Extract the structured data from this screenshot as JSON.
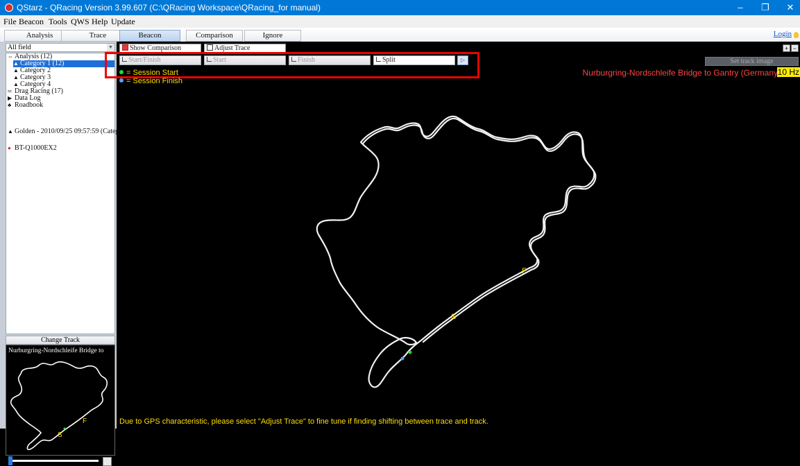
{
  "window": {
    "title": "QStarz - QRacing Version 3.99.607 (C:\\QRacing Workspace\\QRacing_for manual)",
    "controls": [
      "–",
      "❐",
      "✕"
    ]
  },
  "menu": [
    "File",
    "Beacon",
    "Tools",
    "QWS",
    "Help",
    "Update"
  ],
  "tabs": [
    {
      "label": "Analysis"
    },
    {
      "label": "Trace"
    },
    {
      "label": "Beacon"
    },
    {
      "label": "Comparison"
    },
    {
      "label": "Ignore"
    }
  ],
  "login_label": "Login",
  "sidebar": {
    "field_select": "All field",
    "tree": [
      {
        "label": "Analysis (12)",
        "icon": "analysis-icon"
      },
      {
        "label": "Category 1 (12)",
        "icon": "track-icon"
      },
      {
        "label": "Category 2",
        "icon": "track-icon"
      },
      {
        "label": "Category 3",
        "icon": "track-icon"
      },
      {
        "label": "Category 4",
        "icon": "track-icon"
      },
      {
        "label": "Drag Racing (17)",
        "icon": "drag-icon"
      },
      {
        "label": "Data Log",
        "icon": "flag-icon"
      },
      {
        "label": "Roadbook",
        "icon": "roadbook-icon"
      },
      {
        "label": "Golden - 2010/09/25 09:57:59 (Categ",
        "icon": "track-icon"
      },
      {
        "label": "BT-Q1000EX2",
        "icon": "device-icon"
      }
    ],
    "change_track_label": "Change Track",
    "minimap_title": "Nurburgring-Nordschleife Bridge to"
  },
  "toolbar": {
    "show_comparison": "Show Comparison",
    "adjust_trace": "Adjust Trace",
    "start_finish": "Start/Finish",
    "start": "Start",
    "finish": "Finish",
    "split": "Split",
    "set_track_image": "Set track image"
  },
  "legend": {
    "start_text": "= Session Start",
    "finish_text": "= Session Finish",
    "start_color": "#22dd22",
    "finish_color": "#5aa0ff"
  },
  "track": {
    "name": "Nurburgring-Nordschleife Bridge to Gantry (Germany)",
    "rate": "10 Hz",
    "s_marker": "S",
    "f_marker": "F"
  },
  "notice": "Due to GPS characteristic, please select \"Adjust Trace\" to fine tune if finding shifting between trace and track.",
  "colors": {
    "accent": "#0078d7",
    "selection": "#1e6fd9",
    "highlight_box": "#ee0000",
    "marker_text": "#ffde00"
  }
}
